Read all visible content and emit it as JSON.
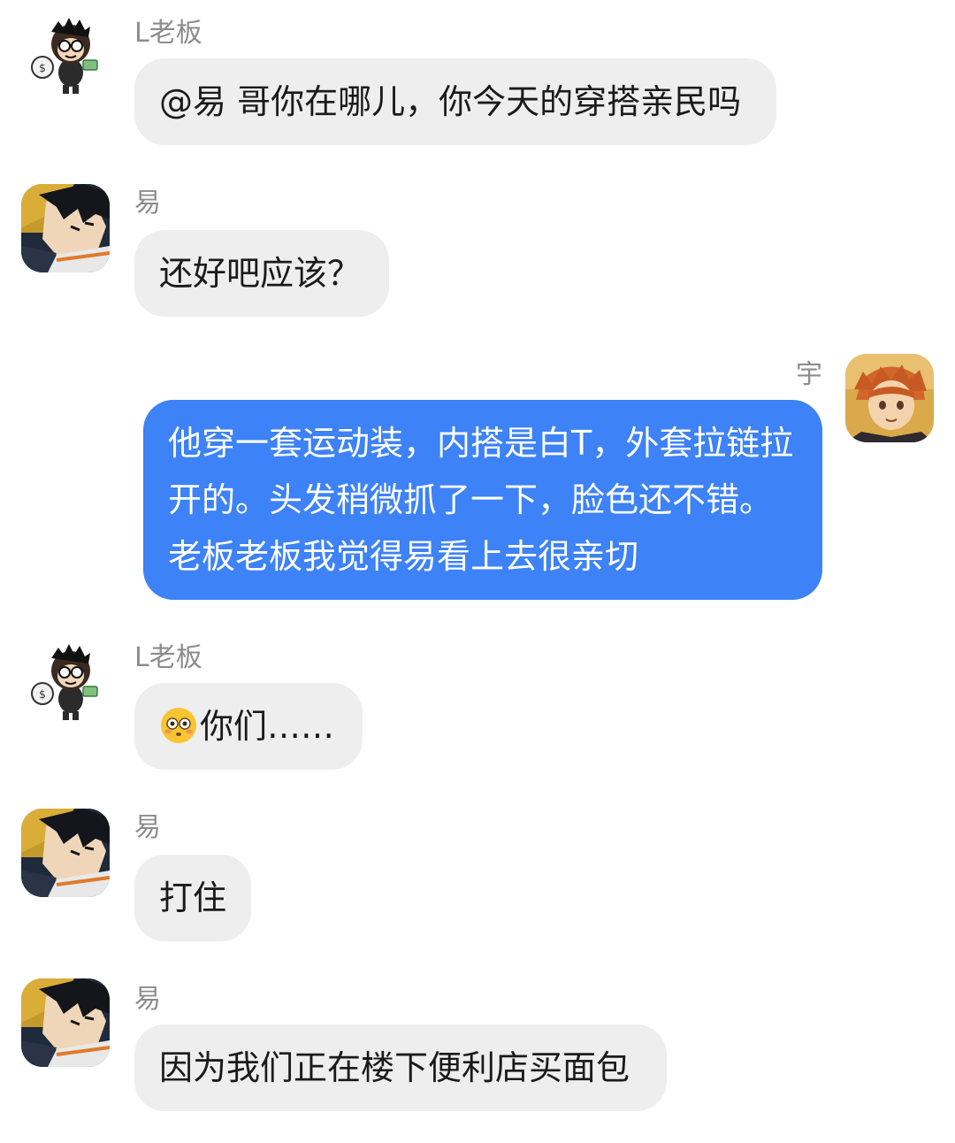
{
  "messages": [
    {
      "sender": "L老板",
      "text": "@易 哥你在哪儿，你今天的穿搭亲民吗",
      "avatar_icon": "cartoon-monkey-avatar-icon"
    },
    {
      "sender": "易",
      "text": "还好吧应该？",
      "avatar_icon": "anime-dark-hair-avatar-icon"
    },
    {
      "sender": "宇",
      "text": "他穿一套运动装，内搭是白T，外套拉链拉开的。头发稍微抓了一下，脸色还不错。老板老板我觉得易看上去很亲切",
      "avatar_icon": "anime-orange-hair-avatar-icon"
    },
    {
      "sender": "L老板",
      "emoji": "flushed-face-emoji",
      "text": "你们……",
      "avatar_icon": "cartoon-monkey-avatar-icon"
    },
    {
      "sender": "易",
      "text": "打住",
      "avatar_icon": "anime-dark-hair-avatar-icon"
    },
    {
      "sender": "易",
      "text": "因为我们正在楼下便利店买面包",
      "avatar_icon": "anime-dark-hair-avatar-icon"
    }
  ],
  "colors": {
    "incoming_bubble": "#eeeeee",
    "outgoing_bubble": "#3d82f6",
    "sender_name": "#8c8c8c"
  }
}
